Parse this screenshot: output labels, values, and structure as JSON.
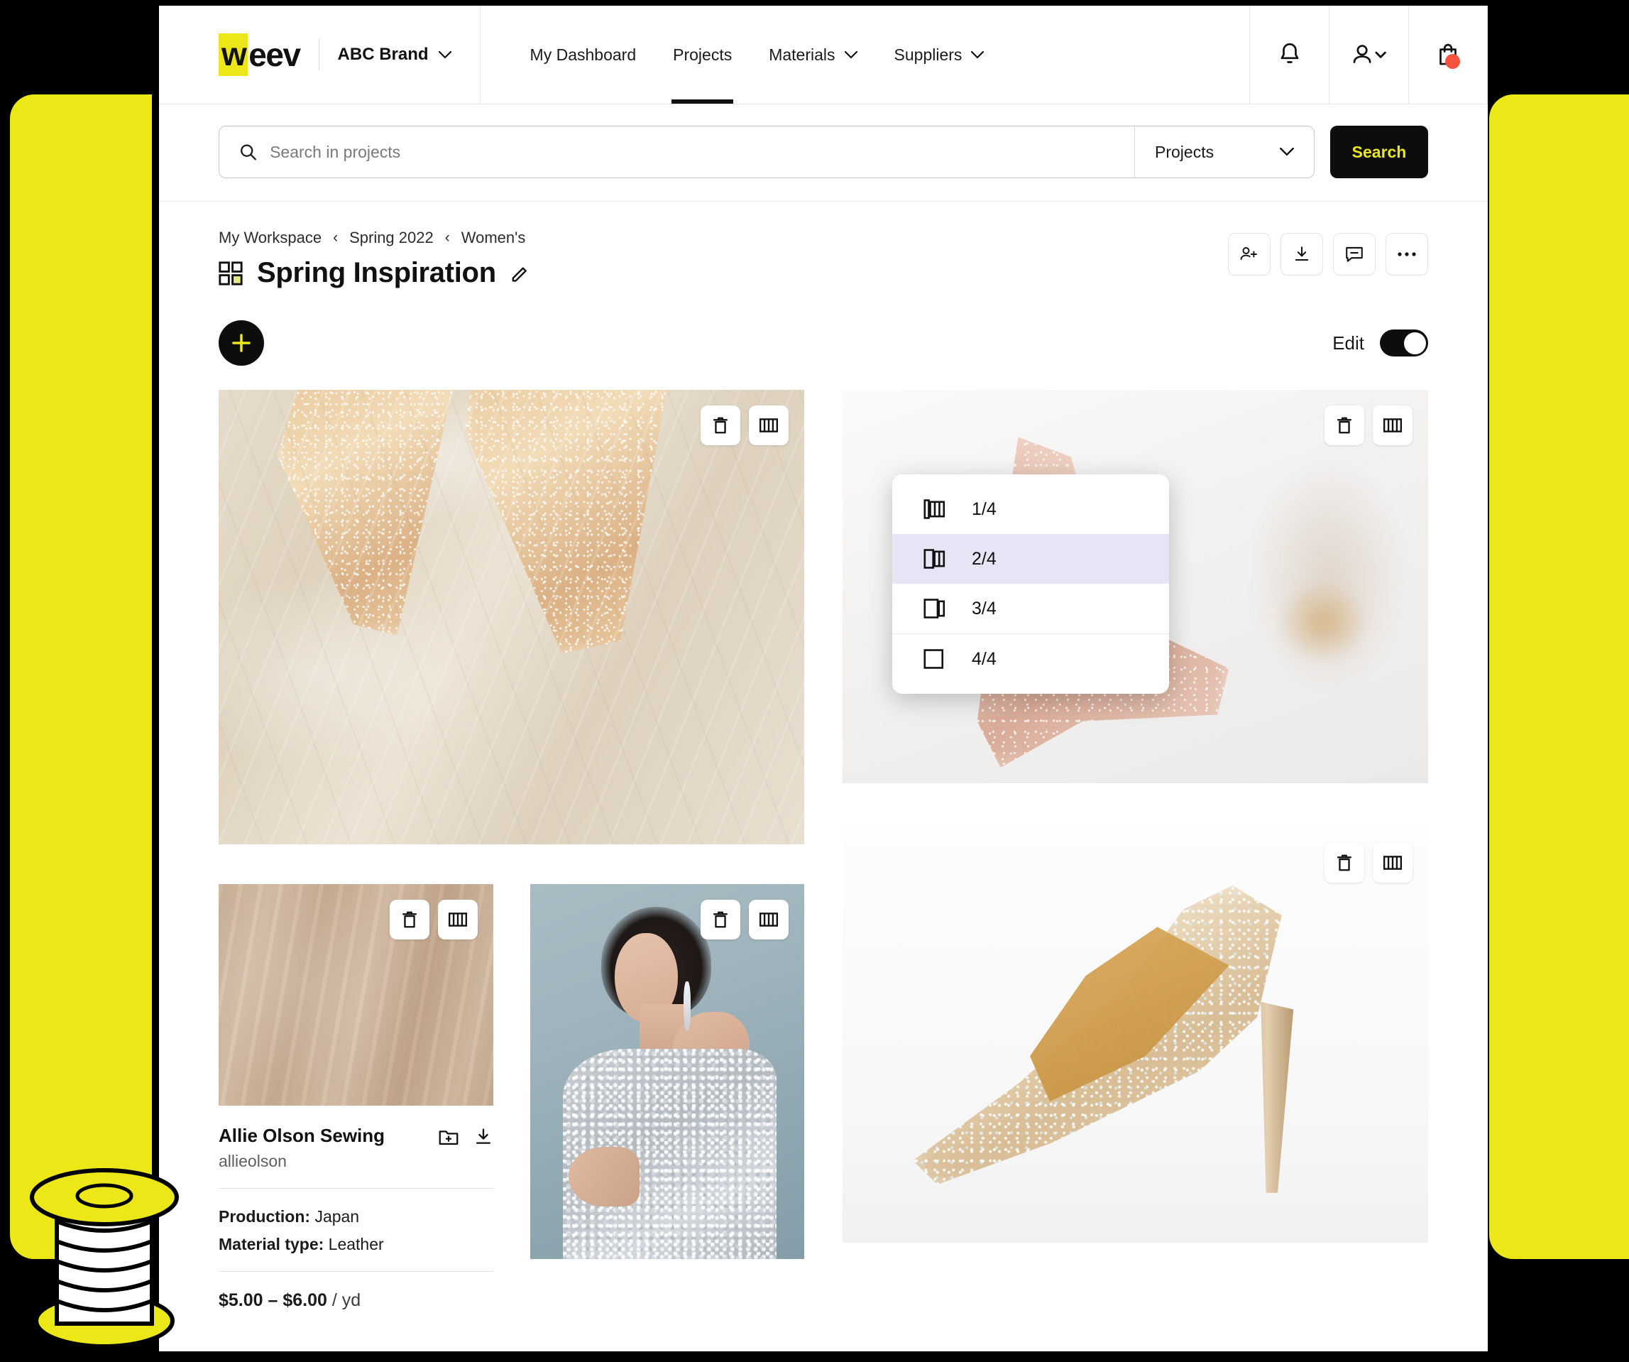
{
  "theme": {
    "accent_yellow": "#ece818",
    "black": "#0d0d0d",
    "badge_red": "#f8523c",
    "selected_lavender": "#e7e4f5"
  },
  "topnav": {
    "logo_w": "w",
    "logo_rest": "eev",
    "brand_name": "ABC Brand",
    "brand_chevron": "chevron-down",
    "links": [
      {
        "label": "My Dashboard",
        "active": false,
        "has_chevron": false
      },
      {
        "label": "Projects",
        "active": true,
        "has_chevron": false
      },
      {
        "label": "Materials",
        "active": false,
        "has_chevron": true
      },
      {
        "label": "Suppliers",
        "active": false,
        "has_chevron": true
      }
    ],
    "actions": [
      {
        "name": "notifications-button",
        "icon": "bell-icon",
        "badge": false
      },
      {
        "name": "account-button",
        "icon": "user-icon",
        "badge": false
      },
      {
        "name": "cart-button",
        "icon": "shopping-bag-icon",
        "badge": true
      }
    ]
  },
  "search": {
    "placeholder": "Search in projects",
    "value": "",
    "scope_value": "Projects",
    "button_label": "Search"
  },
  "page": {
    "breadcrumb": [
      "My Workspace",
      "Spring 2022",
      "Women's"
    ],
    "breadcrumb_separator": "‹",
    "title": "Spring Inspiration",
    "edit_pencil_icon": "pencil-icon",
    "head_actions": [
      {
        "name": "share-invite-button",
        "icon": "person-add-icon"
      },
      {
        "name": "download-button",
        "icon": "download-icon"
      },
      {
        "name": "comments-button",
        "icon": "comment-icon"
      },
      {
        "name": "more-options-button",
        "icon": "ellipsis-icon"
      }
    ]
  },
  "toolbar": {
    "add_icon": "plus-icon",
    "edit_label": "Edit",
    "edit_enabled": true
  },
  "cards": [
    {
      "name": "card-tulle-shoes",
      "image_alt": "Glittery gold pointed-toe shoes on cream tulle fabric",
      "actions": [
        {
          "name": "delete-button",
          "icon": "trash-icon"
        },
        {
          "name": "width-button",
          "icon": "columns-icon"
        }
      ]
    },
    {
      "name": "card-rose-heel",
      "image_alt": "Rose gold glitter stiletto heel on white surface",
      "actions": [
        {
          "name": "delete-button",
          "icon": "trash-icon"
        },
        {
          "name": "width-button",
          "icon": "columns-icon"
        }
      ]
    },
    {
      "name": "card-leather-swatch",
      "image_alt": "Beige draped leather fabric swatch",
      "actions": [
        {
          "name": "delete-button",
          "icon": "trash-icon"
        },
        {
          "name": "width-button",
          "icon": "columns-icon"
        }
      ]
    },
    {
      "name": "card-sequin-model",
      "image_alt": "Model in silver sequin dress against blue-gray backdrop",
      "actions": [
        {
          "name": "delete-button",
          "icon": "trash-icon"
        },
        {
          "name": "width-button",
          "icon": "columns-icon"
        }
      ]
    },
    {
      "name": "card-crystal-pump",
      "image_alt": "Crystal-embellished nude stiletto pump on white background",
      "actions": [
        {
          "name": "delete-button",
          "icon": "trash-icon"
        },
        {
          "name": "width-button",
          "icon": "columns-icon"
        }
      ]
    }
  ],
  "material": {
    "supplier_name": "Allie Olson Sewing",
    "handle": "allieolson",
    "add_to_folder_icon": "folder-plus-icon",
    "download_icon": "download-icon",
    "specs": [
      {
        "label": "Production:",
        "value": "Japan"
      },
      {
        "label": "Material type:",
        "value": "Leather"
      }
    ],
    "price": "$5.00 – $6.00",
    "price_unit": "/ yd"
  },
  "width_menu": {
    "items": [
      {
        "label": "1/4",
        "icon": "width-quarter-icon",
        "selected": false,
        "divider_above": false
      },
      {
        "label": "2/4",
        "icon": "width-half-icon",
        "selected": true,
        "divider_above": false
      },
      {
        "label": "3/4",
        "icon": "width-three-quarter-icon",
        "selected": false,
        "divider_above": false
      },
      {
        "label": "4/4",
        "icon": "width-full-icon",
        "selected": false,
        "divider_above": true
      }
    ]
  }
}
